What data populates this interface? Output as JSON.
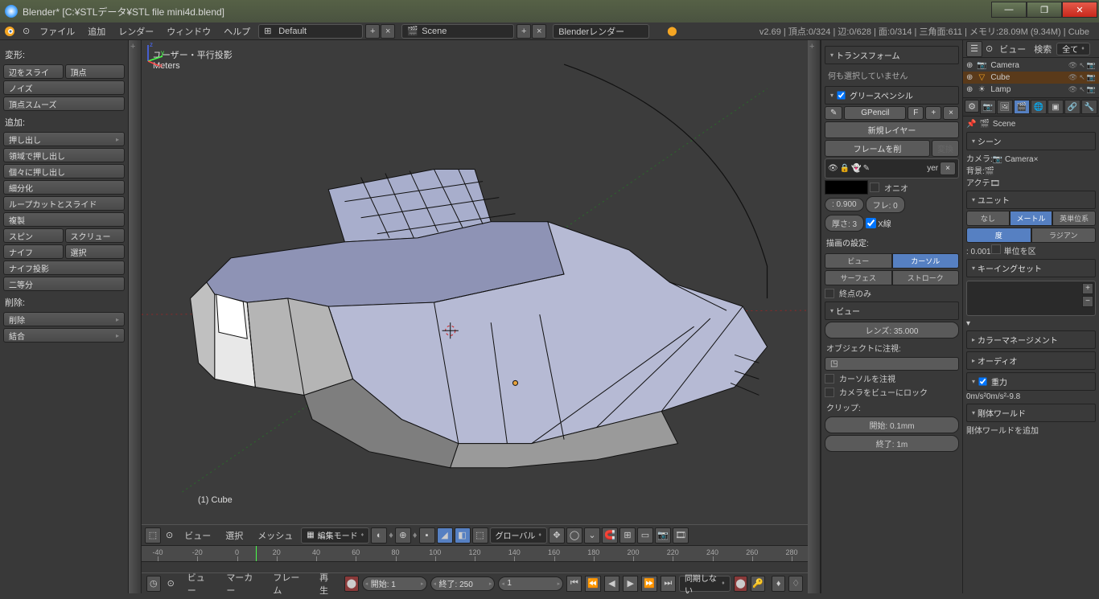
{
  "window": {
    "title": "Blender* [C:¥STLデータ¥STL file mini4d.blend]"
  },
  "menu": {
    "items": [
      "ファイル",
      "追加",
      "レンダー",
      "ウィンドウ",
      "ヘルプ"
    ],
    "layout": "Default",
    "scene": "Scene",
    "engine": "Blenderレンダー"
  },
  "stats": "v2.69 | 頂点:0/324 | 辺:0/628 | 面:0/314 | 三角面:611 | メモリ:28.09M (9.34M) | Cube",
  "tools": {
    "transform_header": "変形:",
    "edge_slide": "辺をスライ",
    "vertex": "頂点",
    "noise": "ノイズ",
    "smooth_vertex": "頂点スムーズ",
    "add_header": "追加:",
    "extrude": "押し出し",
    "extrude_region": "領域で押し出し",
    "extrude_individual": "個々に押し出し",
    "subdivide": "細分化",
    "loopcut": "ループカットとスライド",
    "duplicate": "複製",
    "spin": "スピン",
    "screw": "スクリュー",
    "knife": "ナイフ",
    "select": "選択",
    "knife_project": "ナイフ投影",
    "bisect": "二等分",
    "delete_header": "削除:",
    "delete": "削除",
    "merge": "結合"
  },
  "view3d": {
    "info_line1": "ユーザー・平行投影",
    "info_line2": "Meters",
    "object_name": "(1) Cube"
  },
  "viewheader": {
    "view": "ビュー",
    "select": "選択",
    "mesh": "メッシュ",
    "mode": "編集モード",
    "orientation": "グローバル"
  },
  "npanel": {
    "transform": "トランスフォーム",
    "nothing_selected": "何も選択していません",
    "gpencil": "グリースペンシル",
    "gp_name": "GPencil",
    "gp_f": "F",
    "new_layer": "新規レイヤー",
    "del_frame": "フレームを削",
    "convert": "変換",
    "layer_name": "yer",
    "onion": "オニオ",
    "opacity": ": 0.900",
    "frame": "フレ: 0",
    "thickness": "厚さ: 3",
    "xray": "X線",
    "draw_settings": "描画の設定:",
    "draw_view": "ビュー",
    "draw_cursor": "カーソル",
    "surface": "サーフェス",
    "stroke": "ストローク",
    "endpoints": "終点のみ",
    "view": "ビュー",
    "lens": "レンズ: 35.000",
    "lock_to": "オブジェクトに注視:",
    "lock_cursor": "カーソルを注視",
    "lock_camera": "カメラをビューにロック",
    "clip": "クリップ:",
    "clip_start": "開始: 0.1mm",
    "clip_end": "終了: 1m"
  },
  "outliner": {
    "view": "ビュー",
    "search": "検索",
    "all": "全て",
    "items": [
      {
        "name": "Camera",
        "icon": "📷"
      },
      {
        "name": "Cube",
        "icon": "▽",
        "sel": true
      },
      {
        "name": "Lamp",
        "icon": "☀"
      }
    ]
  },
  "props": {
    "scene_crumb": "Scene",
    "scene_panel": "シーン",
    "camera_lbl": "カメラ:",
    "camera_val": "Camera",
    "background_lbl": "背景:",
    "active_lbl": "アクテ",
    "units_panel": "ユニット",
    "none": "なし",
    "metric": "メートル",
    "imperial": "英単位系",
    "degrees": "度",
    "radians": "ラジアン",
    "unit_scale": ": 0.001",
    "separate": "単位を区",
    "keying": "キーイングセット",
    "colormgmt": "カラーマネージメント",
    "audio": "オーディオ",
    "gravity": "重力",
    "gx": "0m/s²",
    "gy": "0m/s²",
    "gz": "-9.8",
    "rbworld": "剛体ワールド",
    "rbadd": "剛体ワールドを追加"
  },
  "timeline": {
    "ticks": [
      -40,
      -20,
      0,
      20,
      40,
      60,
      80,
      100,
      120,
      140,
      160,
      180,
      200,
      220,
      240,
      260,
      280
    ],
    "current": 1
  },
  "timefoot": {
    "view": "ビュー",
    "marker": "マーカー",
    "frame": "フレーム",
    "playback": "再生",
    "start": "開始: 1",
    "end": "終了: 250",
    "current": "1",
    "sync": "同期しない"
  }
}
